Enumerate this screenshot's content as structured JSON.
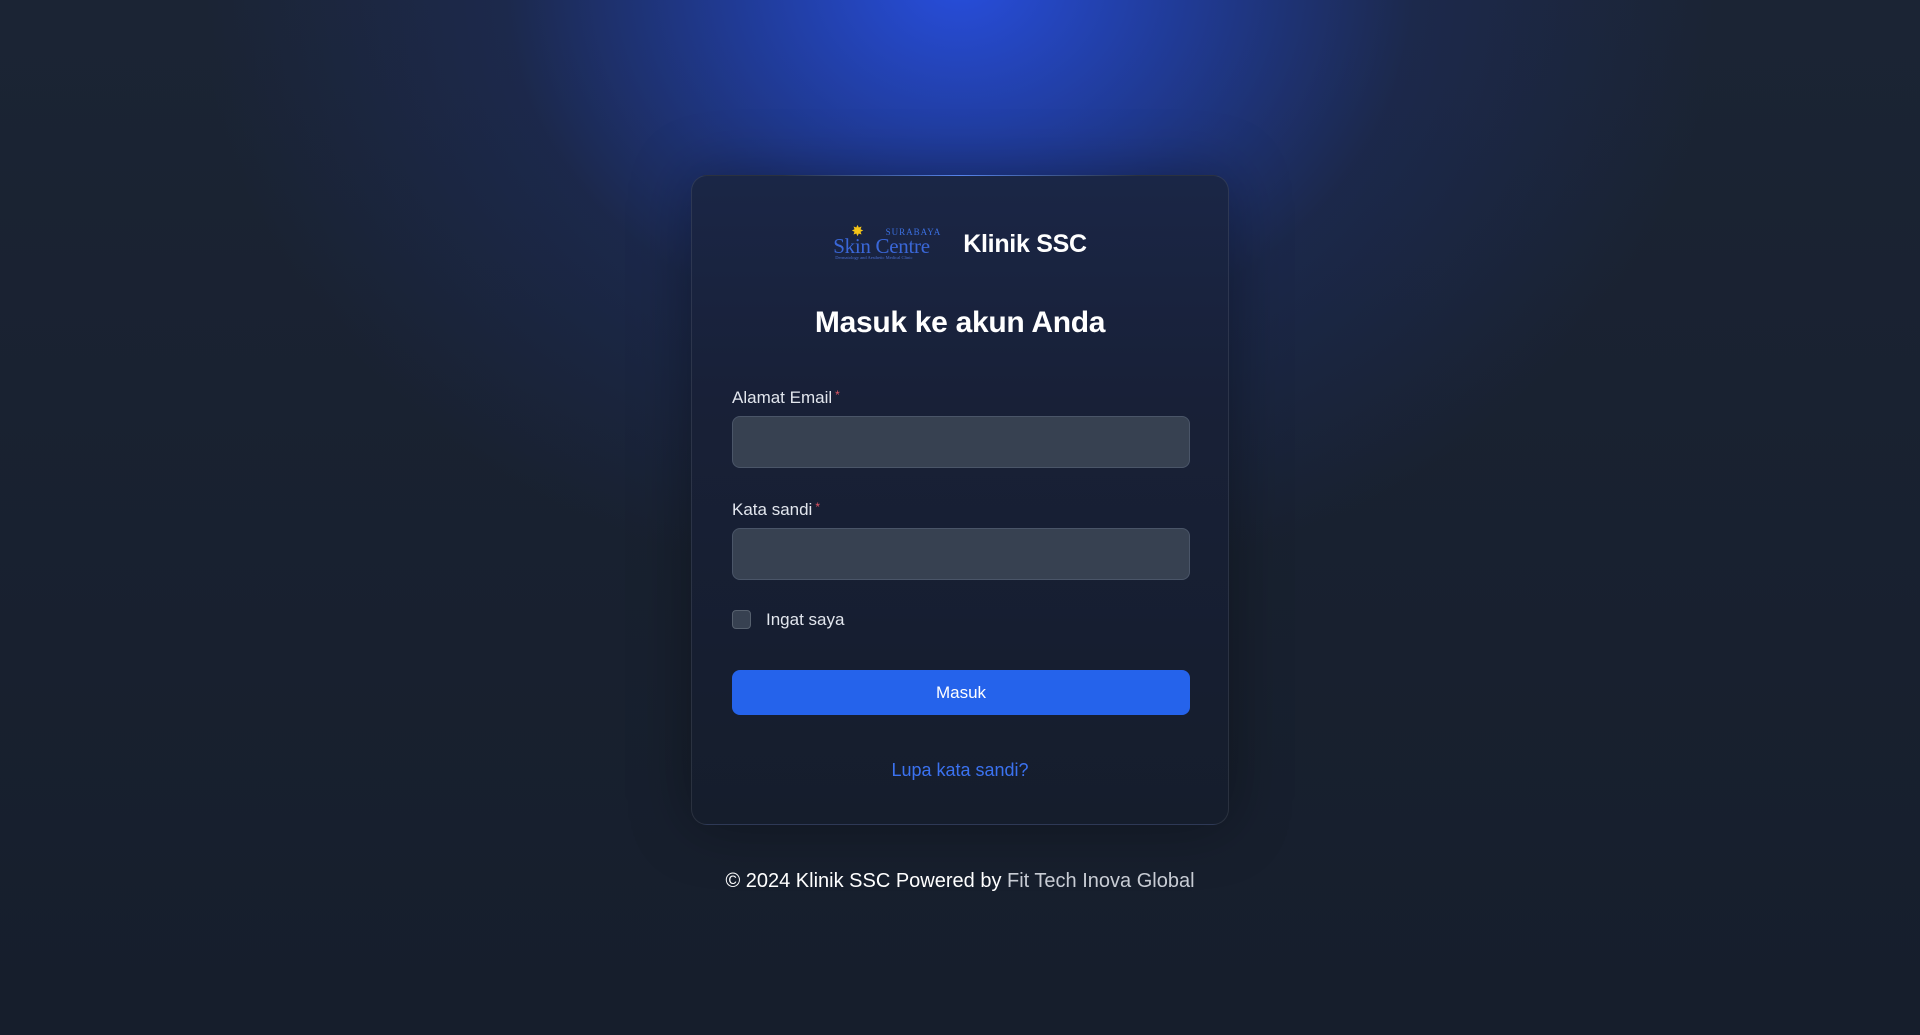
{
  "brand": {
    "logo": {
      "top_text": "SURABAYA",
      "main_text": "Skin Centre",
      "sub_text": "Dermatology and Aesthetic Medical Clinic",
      "icon": "sun-icon",
      "accent_color": "#f5c518"
    },
    "name": "Klinik SSC"
  },
  "form": {
    "heading": "Masuk ke akun Anda",
    "email": {
      "label": "Alamat Email",
      "required_mark": "*",
      "value": "",
      "placeholder": ""
    },
    "password": {
      "label": "Kata sandi",
      "required_mark": "*",
      "value": "",
      "placeholder": ""
    },
    "remember": {
      "label": "Ingat saya",
      "checked": false
    },
    "submit_label": "Masuk",
    "forgot_label": "Lupa kata sandi?"
  },
  "footer": {
    "prefix": "© 2024 Klinik SSC Powered by ",
    "company": "Fit Tech Inova Global"
  },
  "colors": {
    "primary": "#2563eb",
    "link": "#3b72f0",
    "required": "#e25563",
    "background": "#18202e"
  }
}
